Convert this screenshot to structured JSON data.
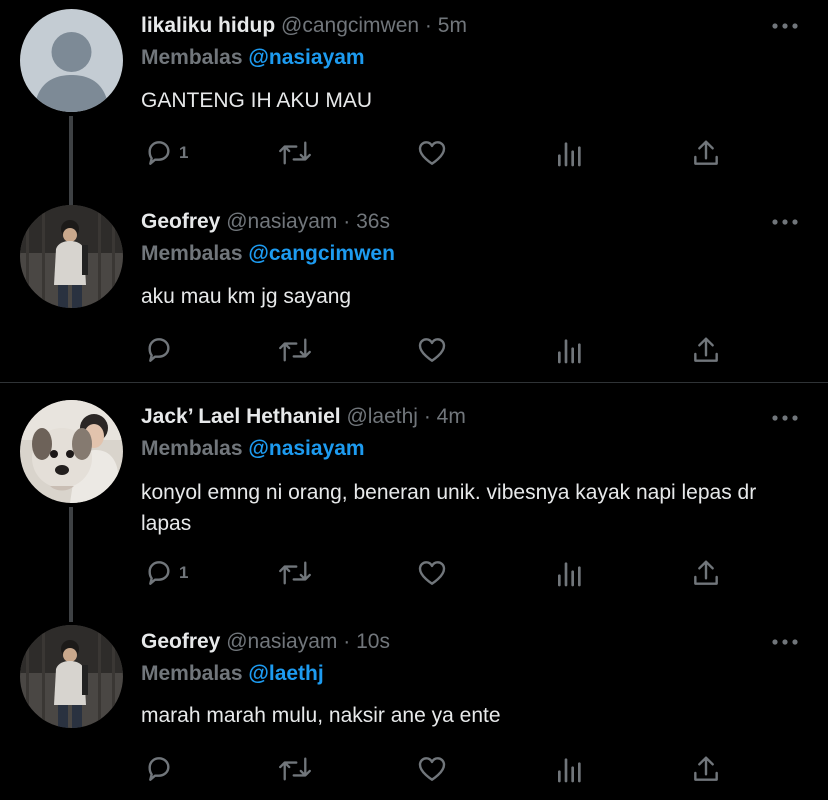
{
  "colors": {
    "background": "#000000",
    "text": "#e7e9ea",
    "secondary": "#71767b",
    "link": "#1d9bf0",
    "thread_line": "#3e4144",
    "divider": "#2f3336"
  },
  "reply_prefix": "Membalas",
  "tweets": [
    {
      "name": "likaliku hidup",
      "handle": "@cangcimwen",
      "separator": "·",
      "time": "5m",
      "reply_to": "@nasiayam",
      "text": "GANTENG IH AKU MAU",
      "reply_count": "1",
      "avatar": "default-avatar"
    },
    {
      "name": "Geofrey",
      "handle": "@nasiayam",
      "separator": "·",
      "time": "36s",
      "reply_to": "@cangcimwen",
      "text": "aku mau km jg sayang",
      "reply_count": "",
      "avatar": "photo-avatar"
    },
    {
      "name": "Jack’ Lael Hethaniel",
      "handle": "@laethj",
      "separator": "·",
      "time": "4m",
      "reply_to": "@nasiayam",
      "text": "konyol emng ni orang, beneran unik. vibesnya kayak napi lepas dr lapas",
      "reply_count": "1",
      "avatar": "photo-avatar-dog"
    },
    {
      "name": "Geofrey",
      "handle": "@nasiayam",
      "separator": "·",
      "time": "10s",
      "reply_to": "@laethj",
      "text": "marah marah mulu, naksir ane ya ente",
      "reply_count": "",
      "avatar": "photo-avatar"
    }
  ]
}
